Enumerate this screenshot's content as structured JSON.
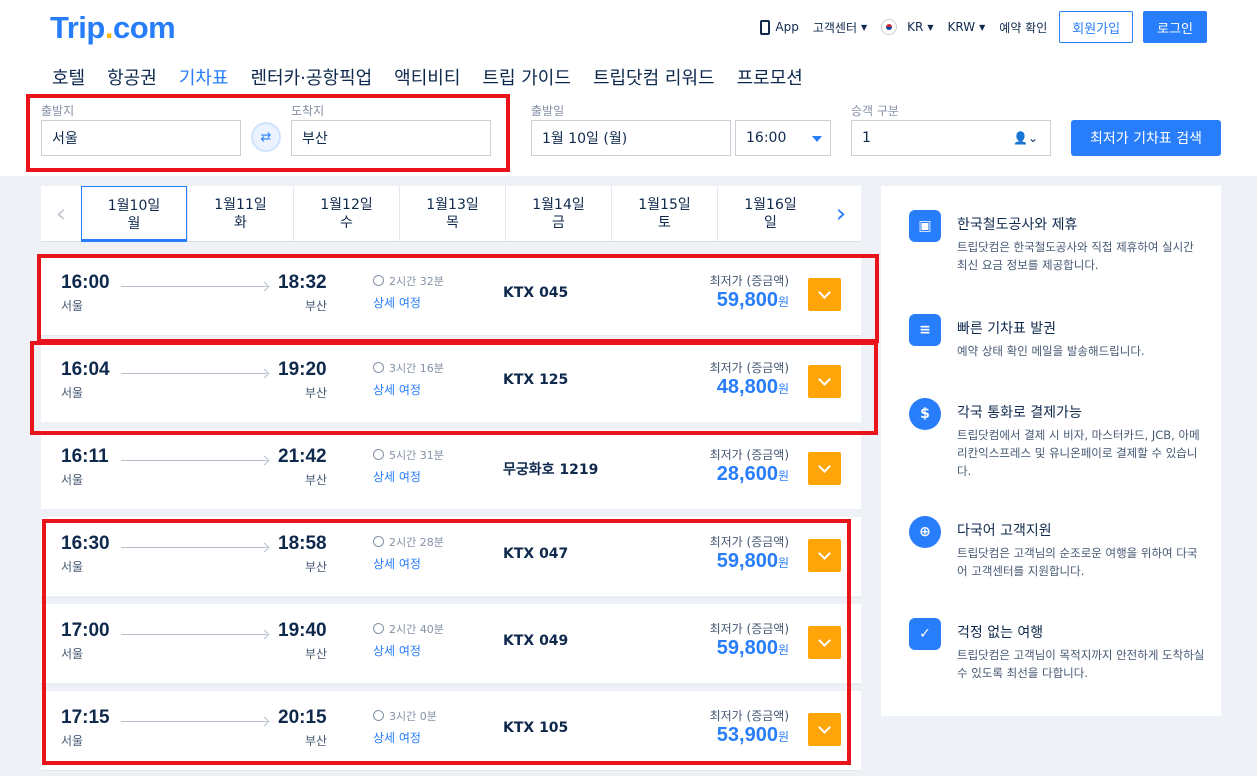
{
  "header": {
    "logo_main": "Trip",
    "logo_dot": ".",
    "logo_tail": "com",
    "top": {
      "app": "App",
      "support": "고객센터",
      "locale": "KR",
      "currency": "KRW",
      "booking_check": "예약 확인",
      "signup": "회원가입",
      "login": "로그인"
    },
    "nav": [
      "호텔",
      "항공권",
      "기차표",
      "렌터카·공항픽업",
      "액티비티",
      "트립 가이드",
      "트립닷컴 리워드",
      "프로모션"
    ]
  },
  "search": {
    "from_label": "출발지",
    "from_value": "서울",
    "to_label": "도착지",
    "to_value": "부산",
    "date_label": "출발일",
    "date_value": "1월 10일 (월)",
    "time_value": "16:00",
    "pax_label": "승객 구분",
    "pax_value": "1",
    "search_button": "최저가 기차표 검색"
  },
  "dates": [
    {
      "date": "1월10일",
      "day": "월"
    },
    {
      "date": "1월11일",
      "day": "화"
    },
    {
      "date": "1월12일",
      "day": "수"
    },
    {
      "date": "1월13일",
      "day": "목"
    },
    {
      "date": "1월14일",
      "day": "금"
    },
    {
      "date": "1월15일",
      "day": "토"
    },
    {
      "date": "1월16일",
      "day": "일"
    }
  ],
  "price_label": "최저가 (증금액)",
  "detail_label": "상세 여정",
  "won": "원",
  "trains": [
    {
      "dep": "16:00",
      "dep_station": "서울",
      "arr": "18:32",
      "arr_station": "부산",
      "duration": "2시간 32분",
      "train": "KTX   045",
      "price": "59,800"
    },
    {
      "dep": "16:04",
      "dep_station": "서울",
      "arr": "19:20",
      "arr_station": "부산",
      "duration": "3시간 16분",
      "train": "KTX   125",
      "price": "48,800"
    },
    {
      "dep": "16:11",
      "dep_station": "서울",
      "arr": "21:42",
      "arr_station": "부산",
      "duration": "5시간 31분",
      "train": "무궁화호   1219",
      "price": "28,600"
    },
    {
      "dep": "16:30",
      "dep_station": "서울",
      "arr": "18:58",
      "arr_station": "부산",
      "duration": "2시간 28분",
      "train": "KTX   047",
      "price": "59,800"
    },
    {
      "dep": "17:00",
      "dep_station": "서울",
      "arr": "19:40",
      "arr_station": "부산",
      "duration": "2시간 40분",
      "train": "KTX   049",
      "price": "59,800"
    },
    {
      "dep": "17:15",
      "dep_station": "서울",
      "arr": "20:15",
      "arr_station": "부산",
      "duration": "3시간 0분",
      "train": "KTX   105",
      "price": "53,900"
    }
  ],
  "features": [
    {
      "icon": "train-ticket-icon",
      "title": "한국철도공사와 제휴",
      "desc": "트립닷컴은 한국철도공사와 직접 제휴하여 실시간 최신 요금 정보를 제공합니다."
    },
    {
      "icon": "fast-ticket-icon",
      "title": "빠른 기차표 발권",
      "desc": "예약 상태 확인 메일을 발송해드립니다."
    },
    {
      "icon": "currency-exchange-icon",
      "title": "각국 통화로 결제가능",
      "desc": "트립닷컴에서 결제 시 비자, 마스터카드, JCB, 아메리칸익스프레스 및 유니온페이로 결제할 수 있습니다."
    },
    {
      "icon": "globe-support-icon",
      "title": "다국어 고객지원",
      "desc": "트립닷컴은 고객님의 순조로운 여행을 위하여 다국어 고객센터를 지원합니다."
    },
    {
      "icon": "shield-check-icon",
      "title": "걱정 없는 여행",
      "desc": "트립닷컴은 고객님이 목적지까지 안전하게 도착하실 수 있도록 최선을 다합니다."
    }
  ],
  "colors": {
    "brand": "#287dfa",
    "accent": "#ffa50a",
    "highlight": "#e8131b"
  }
}
